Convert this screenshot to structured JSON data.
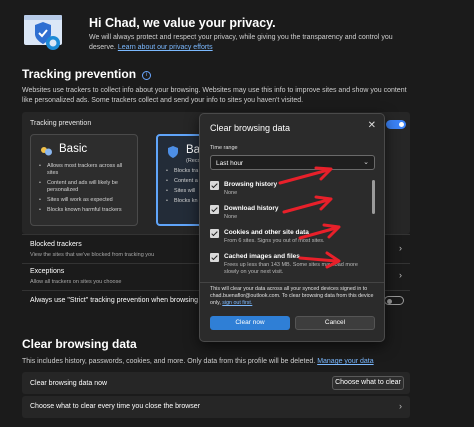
{
  "privacy_header": {
    "title": "Hi Chad, we value your privacy.",
    "body": "We will always protect and respect your privacy, while giving you the transparency and control you deserve.",
    "link": "Learn about our privacy efforts"
  },
  "tracking": {
    "title": "Tracking prevention",
    "description": "Websites use trackers to collect info about your browsing. Websites may use this info to improve sites and show you content like personalized ads. Some trackers collect and send your info to sites you haven't visited.",
    "panel_label": "Tracking prevention",
    "toggle_on": true,
    "cards": [
      {
        "title": "Basic",
        "bullets": [
          "Allows most trackers across all sites",
          "Content and ads will likely be personalized",
          "Sites will work as expected",
          "Blocks known harmful trackers"
        ]
      },
      {
        "title": "Bal",
        "note": "(Reco",
        "bullets": [
          "Blocks tra visited",
          "Content a",
          "Sites will",
          "Blocks kn"
        ]
      }
    ],
    "blocked_title": "Blocked trackers",
    "blocked_sub": "View the sites that we've blocked from tracking you",
    "exceptions_title": "Exceptions",
    "exceptions_sub": "Allow all trackers on sites you choose",
    "inprivate_label": "Always use \"Strict\" tracking prevention when browsing I"
  },
  "clear_section": {
    "title": "Clear browsing data",
    "description": "This includes history, passwords, cookies, and more. Only data from this profile will be deleted.",
    "link": "Manage your data",
    "row1": "Clear browsing data now",
    "row1_button": "Choose what to clear",
    "row2": "Choose what to clear every time you close the browser"
  },
  "dialog": {
    "title": "Clear browsing data",
    "close": "✕",
    "time_range_label": "Time range",
    "time_range_value": "Last hour",
    "options": [
      {
        "title": "Browsing history",
        "sub": "None",
        "checked": true
      },
      {
        "title": "Download history",
        "sub": "None",
        "checked": true
      },
      {
        "title": "Cookies and other site data",
        "sub": "From 6 sites. Signs you out of most sites.",
        "checked": true
      },
      {
        "title": "Cached images and files",
        "sub": "Frees up less than 143 MB. Some sites may load more slowly on your next visit.",
        "checked": true
      }
    ],
    "note_prefix": "This will clear your data across all your synced devices signed in to chad.buenaflor@outlook.com. To clear browsing data from this device only,",
    "note_link": "sign out first.",
    "clear_now": "Clear now",
    "cancel": "Cancel"
  },
  "colors": {
    "background": "#1b1b1b",
    "accent": "#2f7fd6",
    "annotation_arrow": "#e8202a"
  }
}
